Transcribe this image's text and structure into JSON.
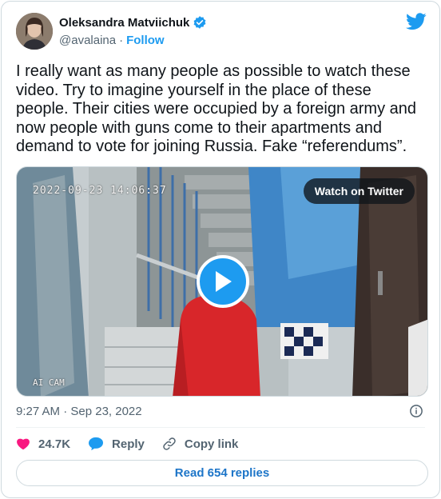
{
  "author": {
    "name": "Oleksandra Matviichuk",
    "handle": "@avalaina",
    "follow_label": "Follow"
  },
  "tweet": {
    "text": "I really want as many people as possible to watch these video. Try to imagine yourself in the place of these people. Their cities were occupied by a foreign army and now people with guns come to their apartments and demand to vote for joining Russia. Fake “referendums”."
  },
  "media": {
    "watch_label": "Watch on Twitter",
    "video_timestamp": "2022-09-23  14:06:37",
    "camera_label": "AI CAM"
  },
  "meta": {
    "date": "9:27 AM · Sep 23, 2022"
  },
  "actions": {
    "likes_count": "24.7K",
    "reply_label": "Reply",
    "copy_link_label": "Copy link"
  },
  "replies_label": "Read 654 replies",
  "colors": {
    "accent": "#1d9bf0",
    "like": "#f91880",
    "text": "#0f1419",
    "muted": "#536471"
  }
}
